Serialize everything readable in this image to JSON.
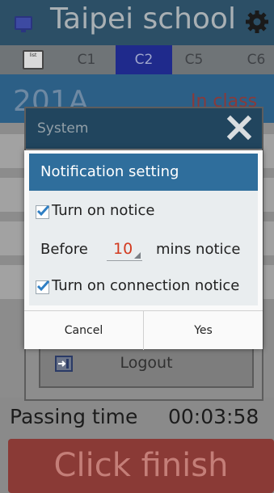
{
  "header": {
    "title": "Taipei school",
    "icons": [
      "monitor-icon",
      "gear-icon"
    ]
  },
  "tabs": [
    {
      "label": "C1",
      "active": false
    },
    {
      "label": "C2",
      "active": true
    },
    {
      "label": "C5",
      "active": false
    },
    {
      "label": "C6",
      "active": false
    }
  ],
  "list_icon_text": "list",
  "class_row": {
    "name": "201A",
    "status": "In class"
  },
  "system_dialog": {
    "title": "System",
    "logout_label": "Logout"
  },
  "notification": {
    "title": "Notification setting",
    "turn_on_notice": {
      "label": "Turn on notice",
      "checked": true
    },
    "before_label": "Before",
    "minutes_value": "10",
    "mins_notice_label": "mins notice",
    "connection_notice": {
      "label": "Turn on connection notice",
      "checked": true
    },
    "cancel_label": "Cancel",
    "yes_label": "Yes"
  },
  "footer": {
    "passing_label": "Passing time",
    "passing_time": "00:03:58",
    "finish_label": "Click finish"
  },
  "colors": {
    "header_bg": "#2c4f66",
    "active_tab": "#1f2a8c",
    "notify_header": "#2f6e9c",
    "minutes_value": "#d23a1f",
    "finish_button": "#8a3a36"
  }
}
